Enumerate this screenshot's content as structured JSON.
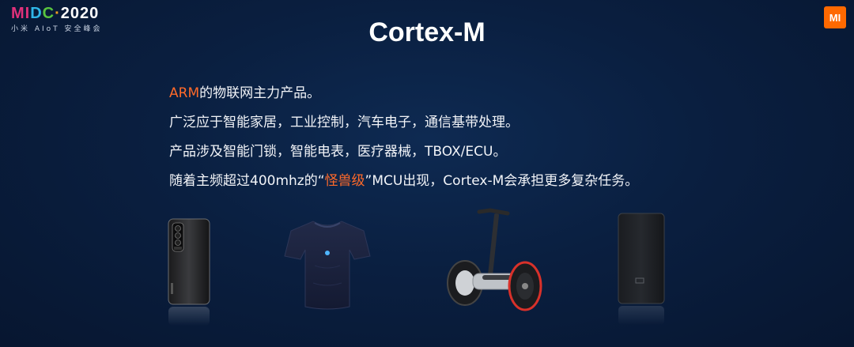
{
  "header": {
    "logo_mi": "MI",
    "logo_d": "D",
    "logo_c": "C",
    "logo_year": "2020",
    "logo_subtitle": "小米 AIoT 安全峰会",
    "brand_badge": "MI"
  },
  "title": "Cortex-M",
  "bullets": [
    {
      "highlight": "ARM",
      "text": "的物联网主力产品。"
    },
    {
      "text": "广泛应于智能家居，工业控制，汽车电子，通信基带处理。"
    },
    {
      "text": "产品涉及智能门锁，智能电表，医疗器械，TBOX/ECU。"
    },
    {
      "pre": "随着主频超过400mhz的“",
      "highlight": "怪兽级",
      "post": "”MCU出现，Cortex-M会承担更多复杂任务。"
    }
  ],
  "products": [
    "phone-image",
    "smart-shirt-image",
    "self-balancing-scooter-image",
    "power-bank-image"
  ],
  "colors": {
    "accent": "#ff6a2a",
    "background": "#0a1f40",
    "brand_orange": "#ff6900"
  }
}
